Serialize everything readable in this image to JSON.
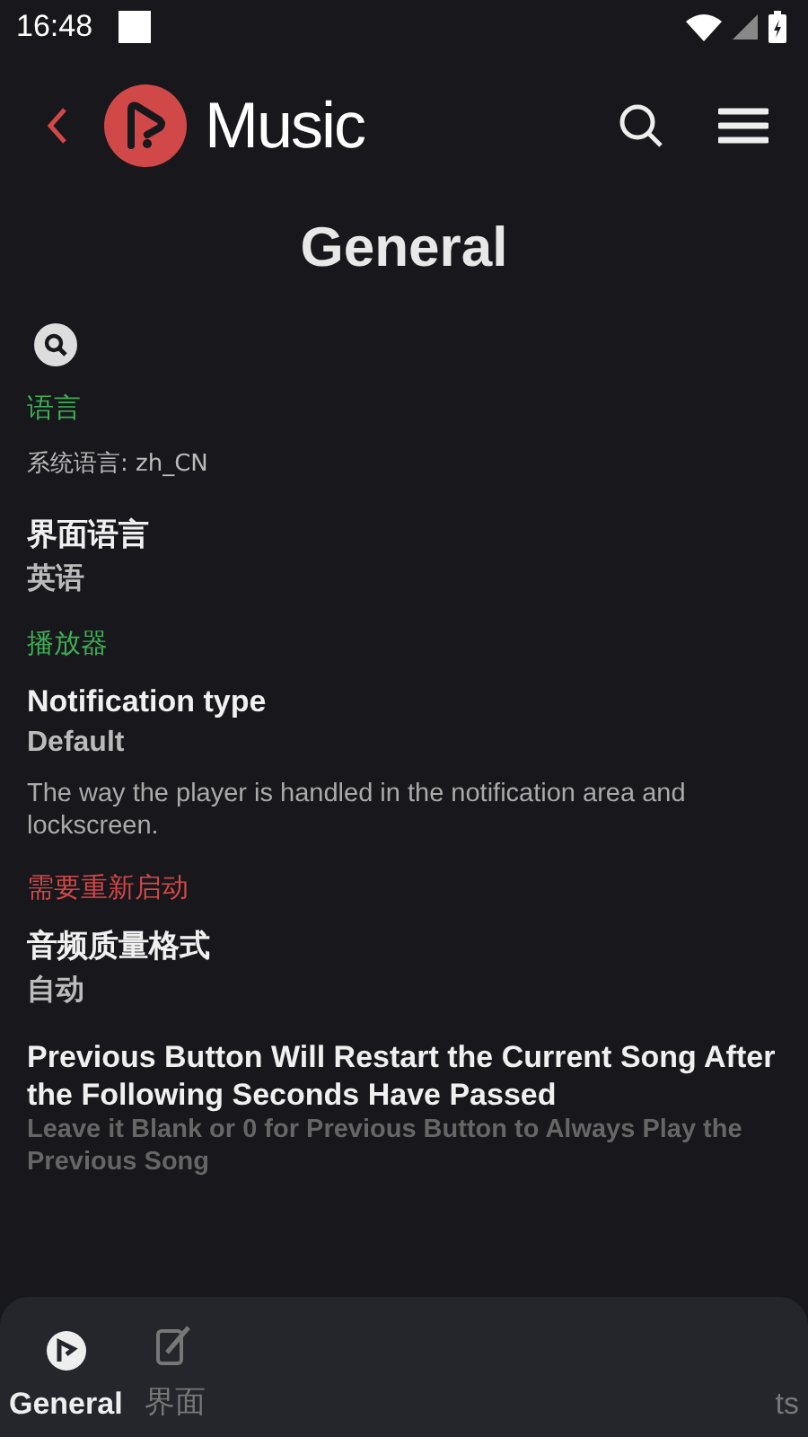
{
  "status_bar": {
    "time": "16:48"
  },
  "header": {
    "app_name": "Music"
  },
  "page_title": "General",
  "items": [
    {
      "kind": "search"
    },
    {
      "kind": "category",
      "label": "语言",
      "color": "#3fae55"
    },
    {
      "kind": "note",
      "text": "系统语言: zh_CN"
    },
    {
      "kind": "setting",
      "title": "界面语言",
      "value": "英语"
    },
    {
      "kind": "category",
      "label": "播放器",
      "color": "#3fae55"
    },
    {
      "kind": "setting",
      "title": "Notification type",
      "value": "Default",
      "description": "The way the player is handled in the notification area and lockscreen."
    },
    {
      "kind": "category",
      "label": "需要重新启动",
      "color": "#d04848"
    },
    {
      "kind": "setting",
      "title": "音频质量格式",
      "value": "自动"
    },
    {
      "kind": "setting",
      "title": "Previous Button Will Restart the Current Song After the Following Seconds Have Passed",
      "description": "Leave it Blank or 0 for Previous Button to Always Play the Previous Song"
    }
  ],
  "bottom_nav": [
    {
      "label": "General",
      "selected": true
    },
    {
      "label": "界面",
      "selected": false
    },
    {
      "label": "ts",
      "selected": false
    }
  ]
}
